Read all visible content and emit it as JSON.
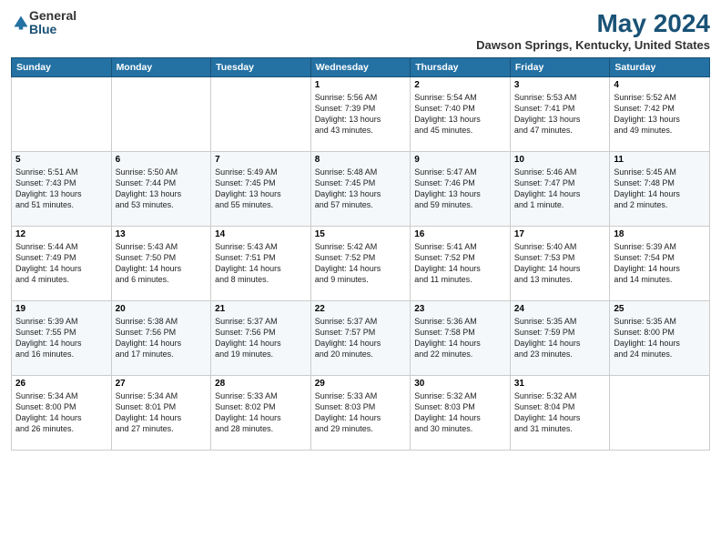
{
  "header": {
    "logo_general": "General",
    "logo_blue": "Blue",
    "month_year": "May 2024",
    "location": "Dawson Springs, Kentucky, United States"
  },
  "weekdays": [
    "Sunday",
    "Monday",
    "Tuesday",
    "Wednesday",
    "Thursday",
    "Friday",
    "Saturday"
  ],
  "weeks": [
    [
      {
        "day": "",
        "info": ""
      },
      {
        "day": "",
        "info": ""
      },
      {
        "day": "",
        "info": ""
      },
      {
        "day": "1",
        "info": "Sunrise: 5:56 AM\nSunset: 7:39 PM\nDaylight: 13 hours\nand 43 minutes."
      },
      {
        "day": "2",
        "info": "Sunrise: 5:54 AM\nSunset: 7:40 PM\nDaylight: 13 hours\nand 45 minutes."
      },
      {
        "day": "3",
        "info": "Sunrise: 5:53 AM\nSunset: 7:41 PM\nDaylight: 13 hours\nand 47 minutes."
      },
      {
        "day": "4",
        "info": "Sunrise: 5:52 AM\nSunset: 7:42 PM\nDaylight: 13 hours\nand 49 minutes."
      }
    ],
    [
      {
        "day": "5",
        "info": "Sunrise: 5:51 AM\nSunset: 7:43 PM\nDaylight: 13 hours\nand 51 minutes."
      },
      {
        "day": "6",
        "info": "Sunrise: 5:50 AM\nSunset: 7:44 PM\nDaylight: 13 hours\nand 53 minutes."
      },
      {
        "day": "7",
        "info": "Sunrise: 5:49 AM\nSunset: 7:45 PM\nDaylight: 13 hours\nand 55 minutes."
      },
      {
        "day": "8",
        "info": "Sunrise: 5:48 AM\nSunset: 7:45 PM\nDaylight: 13 hours\nand 57 minutes."
      },
      {
        "day": "9",
        "info": "Sunrise: 5:47 AM\nSunset: 7:46 PM\nDaylight: 13 hours\nand 59 minutes."
      },
      {
        "day": "10",
        "info": "Sunrise: 5:46 AM\nSunset: 7:47 PM\nDaylight: 14 hours\nand 1 minute."
      },
      {
        "day": "11",
        "info": "Sunrise: 5:45 AM\nSunset: 7:48 PM\nDaylight: 14 hours\nand 2 minutes."
      }
    ],
    [
      {
        "day": "12",
        "info": "Sunrise: 5:44 AM\nSunset: 7:49 PM\nDaylight: 14 hours\nand 4 minutes."
      },
      {
        "day": "13",
        "info": "Sunrise: 5:43 AM\nSunset: 7:50 PM\nDaylight: 14 hours\nand 6 minutes."
      },
      {
        "day": "14",
        "info": "Sunrise: 5:43 AM\nSunset: 7:51 PM\nDaylight: 14 hours\nand 8 minutes."
      },
      {
        "day": "15",
        "info": "Sunrise: 5:42 AM\nSunset: 7:52 PM\nDaylight: 14 hours\nand 9 minutes."
      },
      {
        "day": "16",
        "info": "Sunrise: 5:41 AM\nSunset: 7:52 PM\nDaylight: 14 hours\nand 11 minutes."
      },
      {
        "day": "17",
        "info": "Sunrise: 5:40 AM\nSunset: 7:53 PM\nDaylight: 14 hours\nand 13 minutes."
      },
      {
        "day": "18",
        "info": "Sunrise: 5:39 AM\nSunset: 7:54 PM\nDaylight: 14 hours\nand 14 minutes."
      }
    ],
    [
      {
        "day": "19",
        "info": "Sunrise: 5:39 AM\nSunset: 7:55 PM\nDaylight: 14 hours\nand 16 minutes."
      },
      {
        "day": "20",
        "info": "Sunrise: 5:38 AM\nSunset: 7:56 PM\nDaylight: 14 hours\nand 17 minutes."
      },
      {
        "day": "21",
        "info": "Sunrise: 5:37 AM\nSunset: 7:56 PM\nDaylight: 14 hours\nand 19 minutes."
      },
      {
        "day": "22",
        "info": "Sunrise: 5:37 AM\nSunset: 7:57 PM\nDaylight: 14 hours\nand 20 minutes."
      },
      {
        "day": "23",
        "info": "Sunrise: 5:36 AM\nSunset: 7:58 PM\nDaylight: 14 hours\nand 22 minutes."
      },
      {
        "day": "24",
        "info": "Sunrise: 5:35 AM\nSunset: 7:59 PM\nDaylight: 14 hours\nand 23 minutes."
      },
      {
        "day": "25",
        "info": "Sunrise: 5:35 AM\nSunset: 8:00 PM\nDaylight: 14 hours\nand 24 minutes."
      }
    ],
    [
      {
        "day": "26",
        "info": "Sunrise: 5:34 AM\nSunset: 8:00 PM\nDaylight: 14 hours\nand 26 minutes."
      },
      {
        "day": "27",
        "info": "Sunrise: 5:34 AM\nSunset: 8:01 PM\nDaylight: 14 hours\nand 27 minutes."
      },
      {
        "day": "28",
        "info": "Sunrise: 5:33 AM\nSunset: 8:02 PM\nDaylight: 14 hours\nand 28 minutes."
      },
      {
        "day": "29",
        "info": "Sunrise: 5:33 AM\nSunset: 8:03 PM\nDaylight: 14 hours\nand 29 minutes."
      },
      {
        "day": "30",
        "info": "Sunrise: 5:32 AM\nSunset: 8:03 PM\nDaylight: 14 hours\nand 30 minutes."
      },
      {
        "day": "31",
        "info": "Sunrise: 5:32 AM\nSunset: 8:04 PM\nDaylight: 14 hours\nand 31 minutes."
      },
      {
        "day": "",
        "info": ""
      }
    ]
  ]
}
